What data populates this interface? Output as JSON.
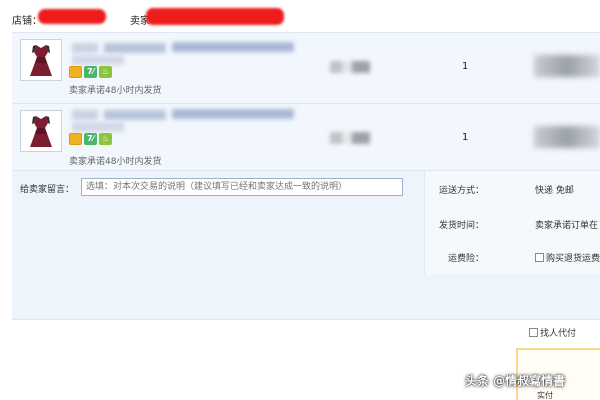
{
  "header": {
    "shop_label": "店铺：",
    "seller_label": "卖家"
  },
  "items": [
    {
      "seller_promise": "卖家承诺48小时内发货",
      "quantity": "1"
    },
    {
      "seller_promise": "卖家承诺48小时内发货",
      "quantity": "1"
    }
  ],
  "badges": {
    "seven": "7⁄",
    "leaf": "♨"
  },
  "message": {
    "label": "给卖家留言：",
    "placeholder": "选填：对本次交易的说明（建议填写已经和卖家达成一致的说明）"
  },
  "shipping": {
    "method_label": "运送方式：",
    "method_value": "快递 免邮",
    "time_label": "发货时间：",
    "time_value": "卖家承诺订单在",
    "insurance_label": "运费险：",
    "insurance_value": "购买退货运费"
  },
  "agent_pay_label": "找人代付",
  "summary_text": "实付",
  "watermark": "头条 @情叔寫情書",
  "colors": {
    "redaction": "#ee1c1c",
    "panel_bg": "#f2f7fd",
    "input_border": "#9bb2cc"
  }
}
